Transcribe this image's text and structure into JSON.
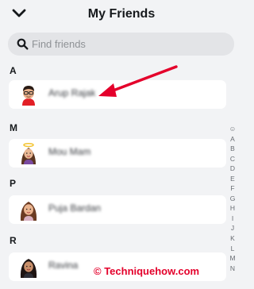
{
  "header": {
    "title": "My Friends"
  },
  "search": {
    "placeholder": "Find friends"
  },
  "sections": [
    {
      "letter": "A",
      "friend_name": "Arup Rajak"
    },
    {
      "letter": "M",
      "friend_name": "Mou Mam"
    },
    {
      "letter": "P",
      "friend_name": "Puja Bardan"
    },
    {
      "letter": "R",
      "friend_name": "Ravina"
    }
  ],
  "alpha_index": [
    "☺",
    "A",
    "B",
    "C",
    "D",
    "E",
    "F",
    "G",
    "H",
    "I",
    "J",
    "K",
    "L",
    "M",
    "N"
  ],
  "watermark": {
    "text": "© Techniquehow.com"
  },
  "annotation": {
    "arrow_color": "#e4002b"
  }
}
